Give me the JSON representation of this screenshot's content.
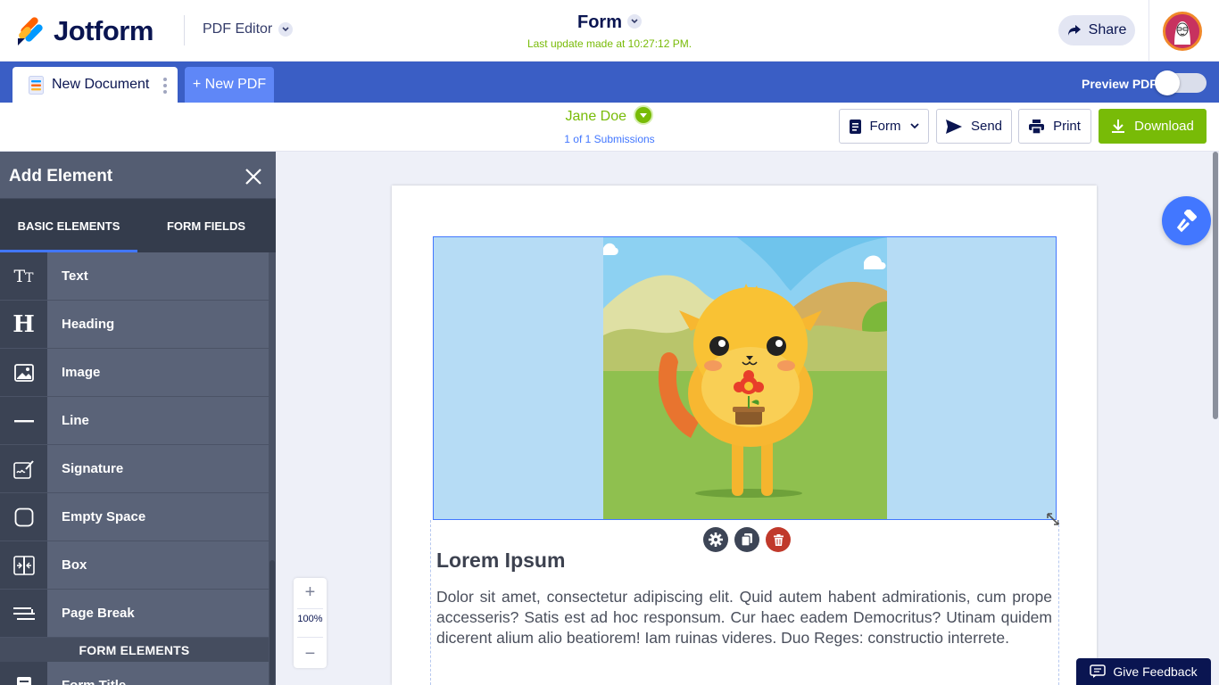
{
  "header": {
    "brand": "Jotform",
    "product_menu": "PDF Editor",
    "form_title": "Form",
    "last_update": "Last update made at 10:27:12 PM.",
    "share_label": "Share"
  },
  "tabbar": {
    "document_tab": "New Document",
    "new_pdf_label": "+ New PDF",
    "preview_label": "Preview PDF",
    "preview_enabled": false
  },
  "toolbar": {
    "submitter_name": "Jane Doe",
    "submission_count": "1 of 1 Submissions",
    "form_button": "Form",
    "send_button": "Send",
    "print_button": "Print",
    "download_button": "Download"
  },
  "sidebar": {
    "title": "Add Element",
    "tabs": [
      {
        "label": "BASIC ELEMENTS",
        "active": true
      },
      {
        "label": "FORM FIELDS",
        "active": false
      }
    ],
    "items": [
      {
        "label": "Text",
        "icon": "text-icon"
      },
      {
        "label": "Heading",
        "icon": "heading-icon"
      },
      {
        "label": "Image",
        "icon": "image-icon"
      },
      {
        "label": "Line",
        "icon": "line-icon"
      },
      {
        "label": "Signature",
        "icon": "signature-icon"
      },
      {
        "label": "Empty Space",
        "icon": "empty-space-icon"
      },
      {
        "label": "Box",
        "icon": "box-icon"
      },
      {
        "label": "Page Break",
        "icon": "page-break-icon"
      }
    ],
    "section_label": "FORM ELEMENTS",
    "partial_item": "Form Title"
  },
  "document": {
    "heading": "Lorem Ipsum",
    "paragraph": "Dolor sit amet, consectetur adipiscing elit. Quid autem habent admirationis, cum prope accesseris? Satis est ad hoc responsum. Cur haec eadem Democritus? Utinam quidem dicerent alium alio beatiorem! Iam ruinas videres. Duo Reges: constructio interrete."
  },
  "zoom": {
    "plus": "+",
    "value": "100%",
    "minus": "−"
  },
  "feedback_label": "Give Feedback",
  "colors": {
    "brand_navy": "#0a1551",
    "tab_bar_blue": "#3a5ec5",
    "accent_blue": "#4277ff",
    "success_green": "#78bb07",
    "sidebar_bg": "#545d72",
    "delete_red": "#c0392b"
  }
}
